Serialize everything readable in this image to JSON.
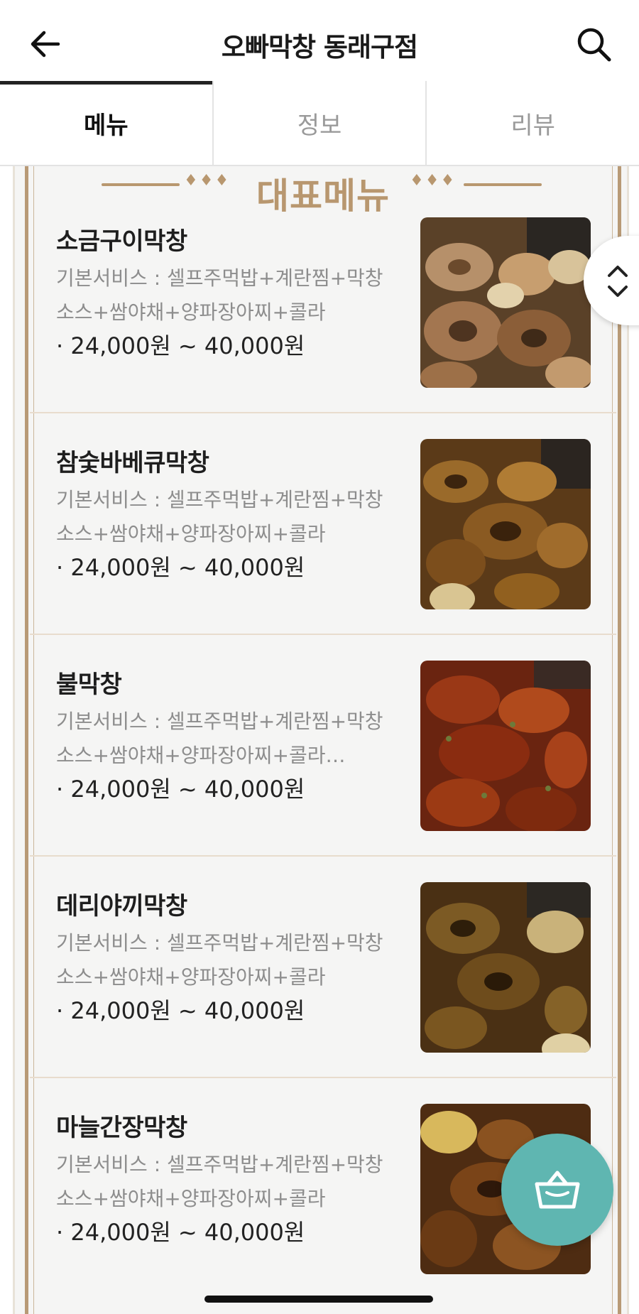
{
  "header": {
    "title": "오빠막창 동래구점",
    "back_icon": "arrow-left-icon",
    "search_icon": "search-icon"
  },
  "tabs": [
    {
      "label": "메뉴",
      "active": true
    },
    {
      "label": "정보",
      "active": false
    },
    {
      "label": "리뷰",
      "active": false
    }
  ],
  "section": {
    "title": "대표메뉴",
    "ornament": "♦♦♦"
  },
  "menu_items": [
    {
      "name": "소금구이막창",
      "description": "기본서비스 : 셀프주먹밥+계란찜+막창소스+쌈야채+양파장아찌+콜라",
      "price": "· 24,000원 ~ 40,000원"
    },
    {
      "name": "참숯바베큐막창",
      "description": "기본서비스 : 셀프주먹밥+계란찜+막창소스+쌈야채+양파장아찌+콜라",
      "price": "· 24,000원 ~ 40,000원"
    },
    {
      "name": "불막창",
      "description": "기본서비스 : 셀프주먹밥+계란찜+막창소스+쌈야채+양파장아찌+콜라…",
      "price": "· 24,000원 ~ 40,000원"
    },
    {
      "name": "데리야끼막창",
      "description": "기본서비스 : 셀프주먹밥+계란찜+막창소스+쌈야채+양파장아찌+콜라",
      "price": "· 24,000원 ~ 40,000원"
    },
    {
      "name": "마늘간장막창",
      "description": "기본서비스 : 셀프주먹밥+계란찜+막창소스+쌈야채+양파장아찌+콜라",
      "price": "· 24,000원 ~ 40,000원"
    }
  ],
  "floating": {
    "sort_icon": "chevron-up-down-icon",
    "cart_icon": "basket-icon"
  },
  "colors": {
    "accent_gold": "#b8976f",
    "cart_teal": "#5fb6b1"
  }
}
